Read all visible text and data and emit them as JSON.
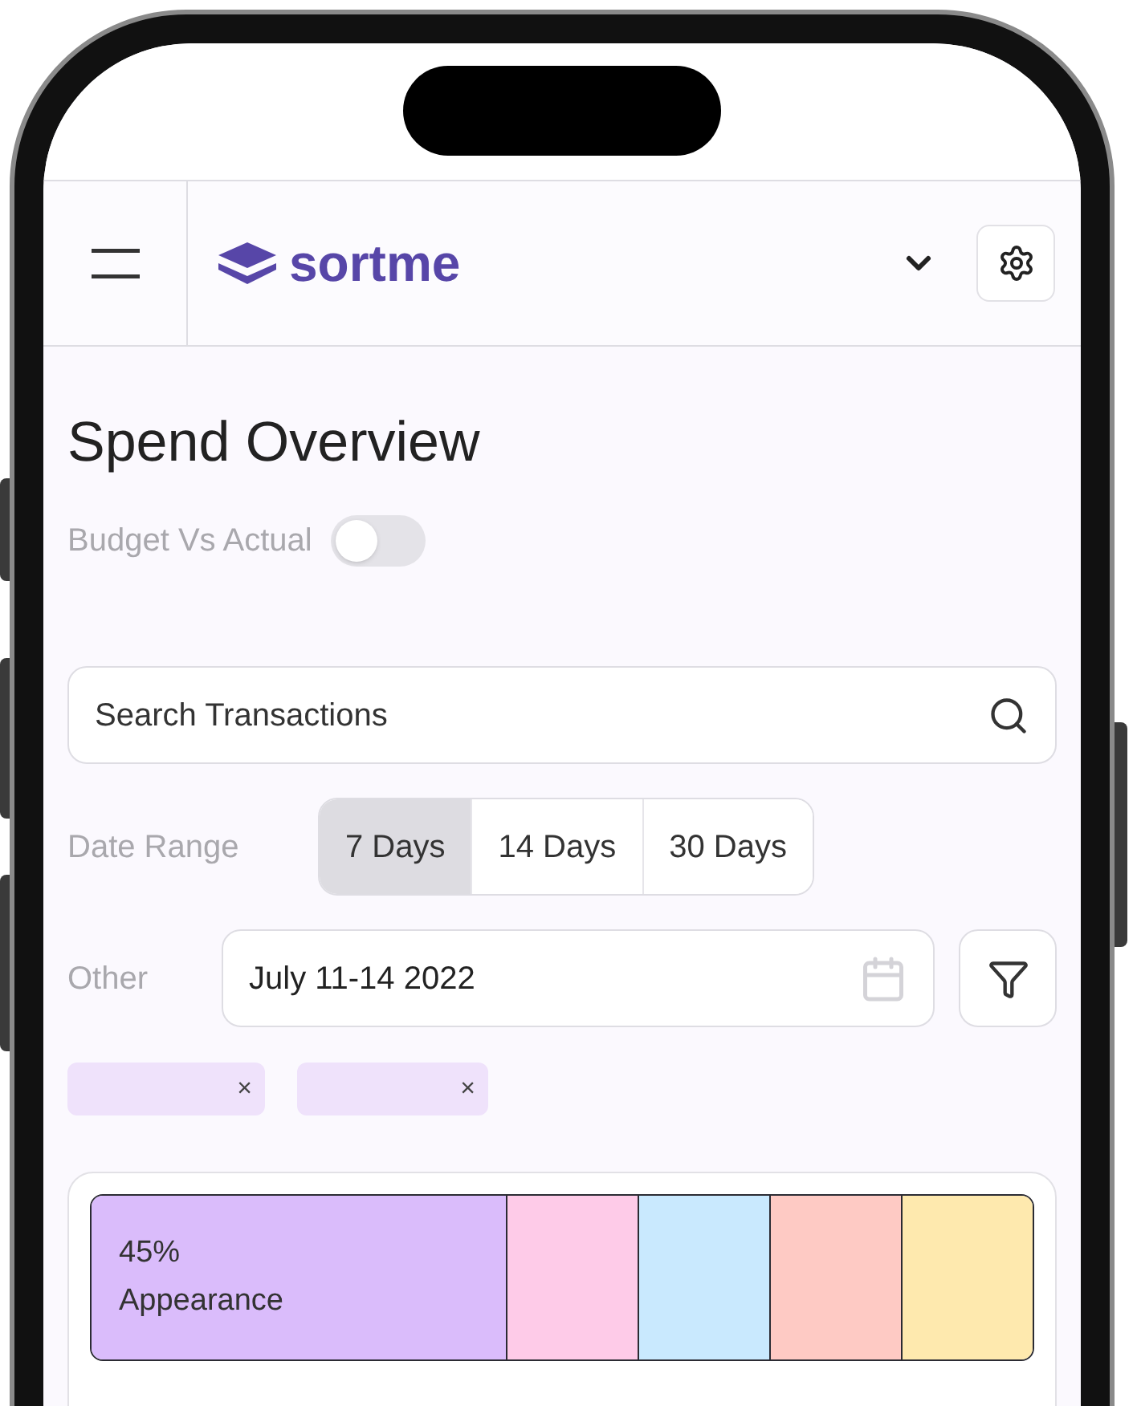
{
  "header": {
    "brand": "sortme"
  },
  "title": "Spend Overview",
  "budget_toggle": {
    "label": "Budget Vs Actual",
    "on": false
  },
  "search": {
    "placeholder": "Search Transactions"
  },
  "date_range": {
    "label": "Date Range",
    "options": [
      {
        "label": "7 Days",
        "selected": true
      },
      {
        "label": "14 Days",
        "selected": false
      },
      {
        "label": "30 Days",
        "selected": false
      }
    ]
  },
  "other": {
    "label": "Other",
    "date": "July 11-14 2022"
  },
  "tags": [
    {
      "remove": "×"
    },
    {
      "remove": "×"
    }
  ],
  "spend_bar": [
    {
      "color": "#dabcfb",
      "percent": "45%",
      "category": "Appearance"
    },
    {
      "color": "#fecbe8"
    },
    {
      "color": "#c9e9fe"
    },
    {
      "color": "#fecac4"
    },
    {
      "color": "#fee9ae"
    }
  ]
}
